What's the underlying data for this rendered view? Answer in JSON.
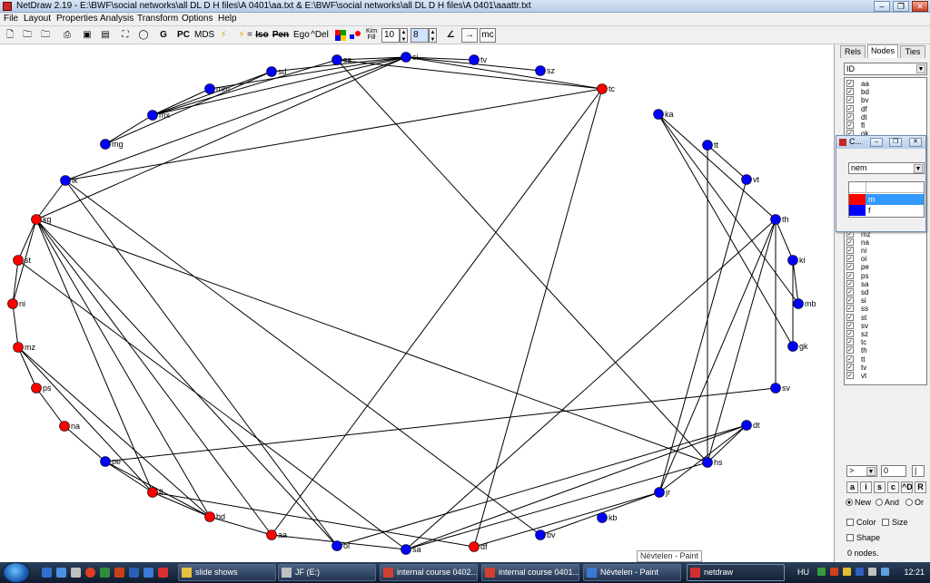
{
  "window": {
    "title": "NetDraw 2.19 - E:\\BWF\\social networks\\all DL D H files\\A 0401\\aa.txt & E:\\BWF\\social networks\\all DL D H files\\A 0401\\aaattr.txt"
  },
  "menu": [
    "File",
    "Layout",
    "Properties",
    "Analysis",
    "Transform",
    "Options",
    "Help"
  ],
  "toolbar": {
    "text_buttons": {
      "g": "G",
      "pc": "PC",
      "mds": "MDS",
      "eq": "=",
      "iso": "Iso",
      "pen": "Pen",
      "ego": "Ego",
      "del": "^Del",
      "kim": "Kim",
      "fill": "Fill",
      "mc": "mc",
      "arrow": "→"
    },
    "spin1": "10",
    "spin2": "8"
  },
  "colors": {
    "red": "#ff0000",
    "blue": "#0000ff",
    "selection": "#3399ff",
    "edge": "#000000"
  },
  "network": {
    "nodes": [
      {
        "id": "aa",
        "group": "red"
      },
      {
        "id": "bd",
        "group": "red"
      },
      {
        "id": "bv",
        "group": "blue"
      },
      {
        "id": "df",
        "group": "red"
      },
      {
        "id": "dt",
        "group": "blue"
      },
      {
        "id": "fl",
        "group": "red"
      },
      {
        "id": "gk",
        "group": "blue"
      },
      {
        "id": "hs",
        "group": "blue"
      },
      {
        "id": "jr",
        "group": "blue"
      },
      {
        "id": "ka",
        "group": "blue"
      },
      {
        "id": "kb",
        "group": "blue"
      },
      {
        "id": "kg",
        "group": "red"
      },
      {
        "id": "ki",
        "group": "blue"
      },
      {
        "id": "lk",
        "group": "blue"
      },
      {
        "id": "mb",
        "group": "blue"
      },
      {
        "id": "mg",
        "group": "blue"
      },
      {
        "id": "mm",
        "group": "blue"
      },
      {
        "id": "mx",
        "group": "blue"
      },
      {
        "id": "mz",
        "group": "red"
      },
      {
        "id": "na",
        "group": "red"
      },
      {
        "id": "ni",
        "group": "red"
      },
      {
        "id": "oi",
        "group": "blue"
      },
      {
        "id": "pe",
        "group": "blue"
      },
      {
        "id": "ps",
        "group": "red"
      },
      {
        "id": "sa",
        "group": "blue"
      },
      {
        "id": "sd",
        "group": "blue"
      },
      {
        "id": "si",
        "group": "blue"
      },
      {
        "id": "ss",
        "group": "blue"
      },
      {
        "id": "st",
        "group": "red"
      },
      {
        "id": "sv",
        "group": "blue"
      },
      {
        "id": "sz",
        "group": "blue"
      },
      {
        "id": "tc",
        "group": "red"
      },
      {
        "id": "th",
        "group": "blue"
      },
      {
        "id": "tt",
        "group": "blue"
      },
      {
        "id": "tv",
        "group": "blue"
      },
      {
        "id": "vt",
        "group": "blue"
      }
    ],
    "edges": [
      [
        "kg",
        "lk"
      ],
      [
        "kg",
        "st"
      ],
      [
        "kg",
        "ni"
      ],
      [
        "kg",
        "fl"
      ],
      [
        "kg",
        "bd"
      ],
      [
        "kg",
        "aa"
      ],
      [
        "kg",
        "oi"
      ],
      [
        "kg",
        "hs"
      ],
      [
        "kg",
        "si"
      ],
      [
        "st",
        "sa"
      ],
      [
        "st",
        "ni"
      ],
      [
        "ni",
        "mz"
      ],
      [
        "mz",
        "ps"
      ],
      [
        "mz",
        "fl"
      ],
      [
        "mz",
        "bd"
      ],
      [
        "ps",
        "na"
      ],
      [
        "na",
        "pe"
      ],
      [
        "pe",
        "fl"
      ],
      [
        "pe",
        "bd"
      ],
      [
        "pe",
        "sv"
      ],
      [
        "fl",
        "bd"
      ],
      [
        "fl",
        "df"
      ],
      [
        "bd",
        "aa"
      ],
      [
        "aa",
        "sa"
      ],
      [
        "aa",
        "tc"
      ],
      [
        "oi",
        "lk"
      ],
      [
        "oi",
        "dt"
      ],
      [
        "sa",
        "th"
      ],
      [
        "sa",
        "dt"
      ],
      [
        "sa",
        "hs"
      ],
      [
        "df",
        "tc"
      ],
      [
        "df",
        "jr"
      ],
      [
        "bv",
        "jr"
      ],
      [
        "bv",
        "lk"
      ],
      [
        "ss",
        "tc"
      ],
      [
        "ss",
        "hs"
      ],
      [
        "ss",
        "mx"
      ],
      [
        "si",
        "lk"
      ],
      [
        "si",
        "mm"
      ],
      [
        "si",
        "sd"
      ],
      [
        "si",
        "ss"
      ],
      [
        "si",
        "tv"
      ],
      [
        "si",
        "sz"
      ],
      [
        "si",
        "mx"
      ],
      [
        "si",
        "tc"
      ],
      [
        "mx",
        "mm"
      ],
      [
        "mx",
        "sd"
      ],
      [
        "mg",
        "sd"
      ],
      [
        "mg",
        "mx"
      ],
      [
        "lk",
        "tc"
      ],
      [
        "ka",
        "mb"
      ],
      [
        "ka",
        "gk"
      ],
      [
        "ka",
        "th"
      ],
      [
        "tt",
        "vt"
      ],
      [
        "tt",
        "hs"
      ],
      [
        "vt",
        "jr"
      ],
      [
        "th",
        "hs"
      ],
      [
        "th",
        "jr"
      ],
      [
        "th",
        "ki"
      ],
      [
        "sv",
        "th"
      ],
      [
        "ki",
        "mb"
      ],
      [
        "ki",
        "gk"
      ],
      [
        "dt",
        "hs"
      ],
      [
        "dt",
        "jr"
      ]
    ]
  },
  "right_panel": {
    "tabs": [
      "Rels",
      "Nodes",
      "Ties"
    ],
    "attribute_select": "ID",
    "node_list": [
      "aa",
      "bd",
      "bv",
      "df",
      "dt",
      "fl",
      "gk",
      "mz",
      "na",
      "ni",
      "oi",
      "pe",
      "ps",
      "sa",
      "sd",
      "si",
      "ss",
      "st",
      "sv",
      "sz",
      "tc",
      "th",
      "tt",
      "tv",
      "vt"
    ],
    "operator": ">",
    "threshold": "0",
    "buttons": [
      "a",
      "i",
      "s",
      "c",
      "^D",
      "R"
    ],
    "radio": [
      "New",
      "And",
      "Or"
    ],
    "checkboxes": [
      "Color",
      "Size",
      "Shape"
    ],
    "status": "0 nodes."
  },
  "popup": {
    "title": "C...",
    "attribute": "nem",
    "legend": [
      {
        "label": "m",
        "color": "#ff0000",
        "selected": true
      },
      {
        "label": "f",
        "color": "#0000ff",
        "selected": false
      }
    ]
  },
  "tooltip": "Névtelen - Paint",
  "taskbar": {
    "tasks": [
      {
        "label": "slide shows",
        "active": false
      },
      {
        "label": "JF (E:)",
        "active": false
      },
      {
        "label": "internal course 0402...",
        "active": false
      },
      {
        "label": "internal course 0401...",
        "active": false
      },
      {
        "label": "Névtelen - Paint",
        "active": false
      },
      {
        "label": "netdraw",
        "active": true
      }
    ],
    "language": "HU",
    "clock": "12:21"
  }
}
